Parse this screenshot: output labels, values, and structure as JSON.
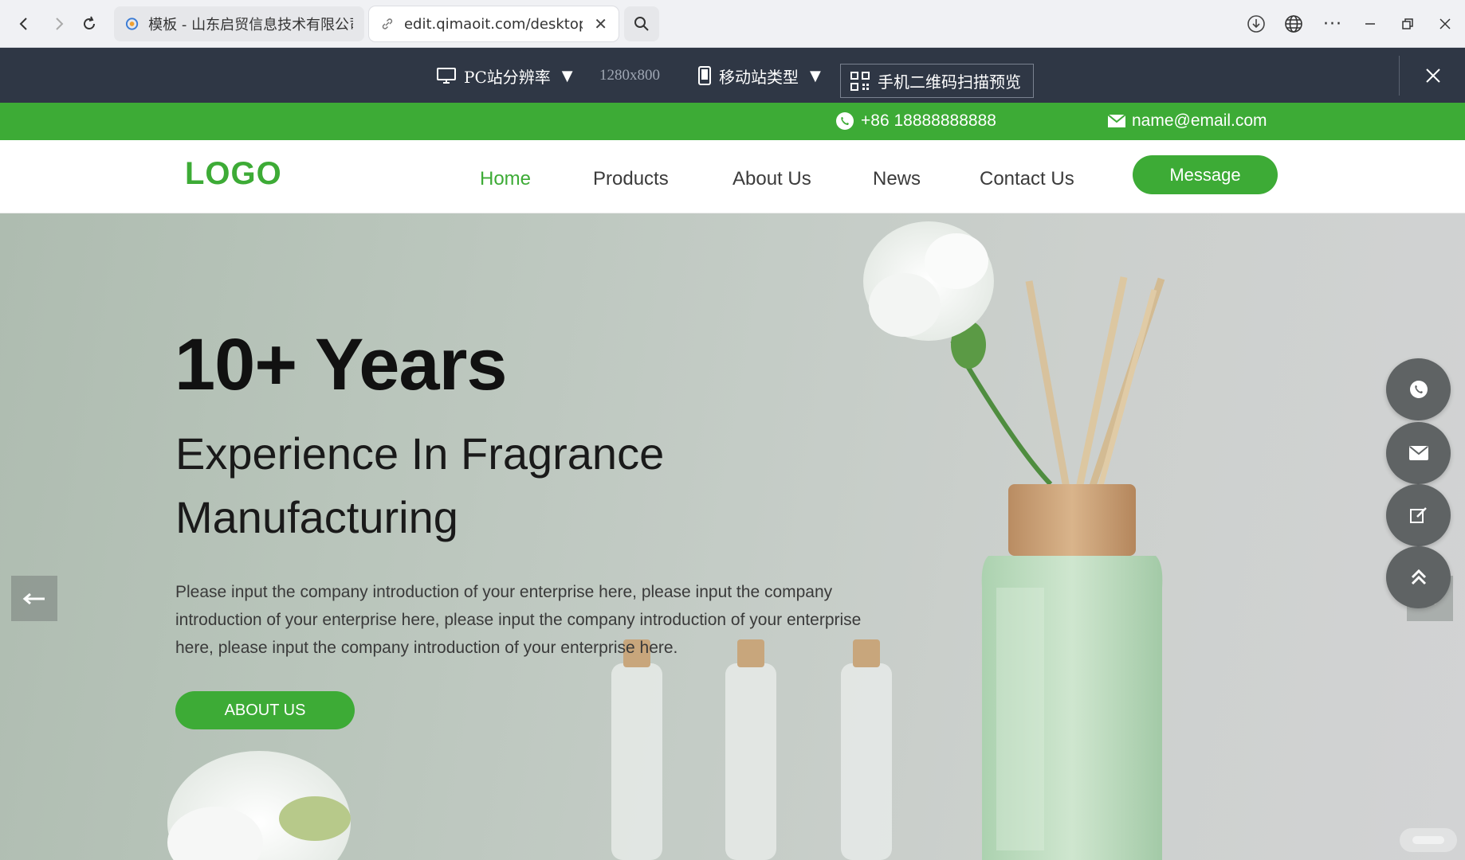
{
  "browser": {
    "tabs": [
      {
        "title": "模板 - 山东启贸信息技术有限公司"
      },
      {
        "title": "edit.qimaoit.com/desktop/i"
      }
    ]
  },
  "preview_bar": {
    "pc_resolution_label": "PC站分辨率",
    "resolution": "1280x800",
    "mobile_type_label": "移动站类型",
    "qr_preview_label": "手机二维码扫描预览"
  },
  "contact": {
    "phone": "+86 18888888888",
    "email": "name@email.com"
  },
  "header": {
    "logo": "LOGO",
    "menu": [
      "Home",
      "Products",
      "About Us",
      "News",
      "Contact Us"
    ],
    "active_menu": "Home",
    "message_button": "Message"
  },
  "hero": {
    "title": "10+ Years",
    "subtitle": "Experience In Fragrance Manufacturing",
    "description": "Please input the company introduction of your enterprise here, please input the company introduction of your enterprise here, please input the company introduction of your enterprise here, please input the company introduction of your enterprise here.",
    "button": "ABOUT US"
  },
  "floating_buttons": [
    "whatsapp-icon",
    "mail-icon",
    "edit-icon",
    "back-to-top-icon"
  ],
  "colors": {
    "brand_green": "#3dab36",
    "toolbar_dark": "#2f3745"
  }
}
